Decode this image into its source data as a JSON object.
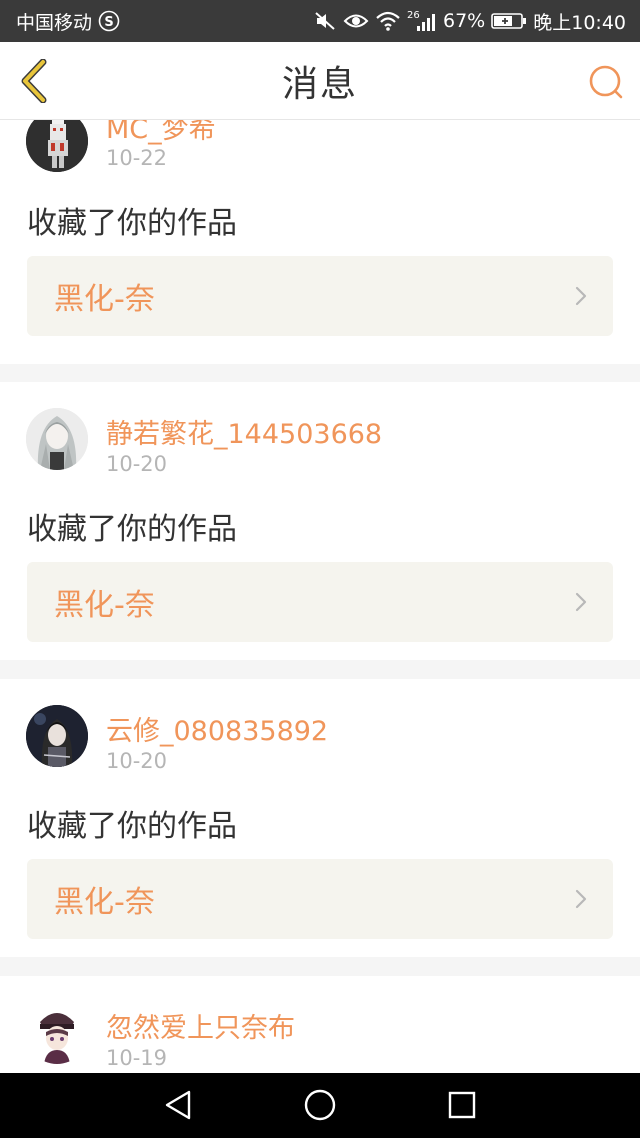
{
  "status_bar": {
    "carrier": "中国移动",
    "network_badge": "26",
    "battery_percent": "67%",
    "time": "晚上10:40",
    "icons": [
      "carrier-s-icon",
      "mute-icon",
      "eye-icon",
      "wifi-icon",
      "signal-icon",
      "battery-icon"
    ]
  },
  "header": {
    "title": "消息",
    "back_icon": "chevron-left-icon",
    "search_icon": "search-icon",
    "accent_color": "#f0955a",
    "back_color": "#c9a227"
  },
  "messages": [
    {
      "user": "MC_梦希",
      "date": "10-22",
      "action": "收藏了你的作品",
      "work": "黑化-奈"
    },
    {
      "user": "静若繁花_144503668",
      "date": "10-20",
      "action": "收藏了你的作品",
      "work": "黑化-奈"
    },
    {
      "user": "云修_080835892",
      "date": "10-20",
      "action": "收藏了你的作品",
      "work": "黑化-奈"
    },
    {
      "user": "忽然爱上只奈布",
      "date": "10-19"
    }
  ],
  "nav_bar": {
    "icons": [
      "back-triangle-icon",
      "home-circle-icon",
      "recents-square-icon"
    ]
  }
}
